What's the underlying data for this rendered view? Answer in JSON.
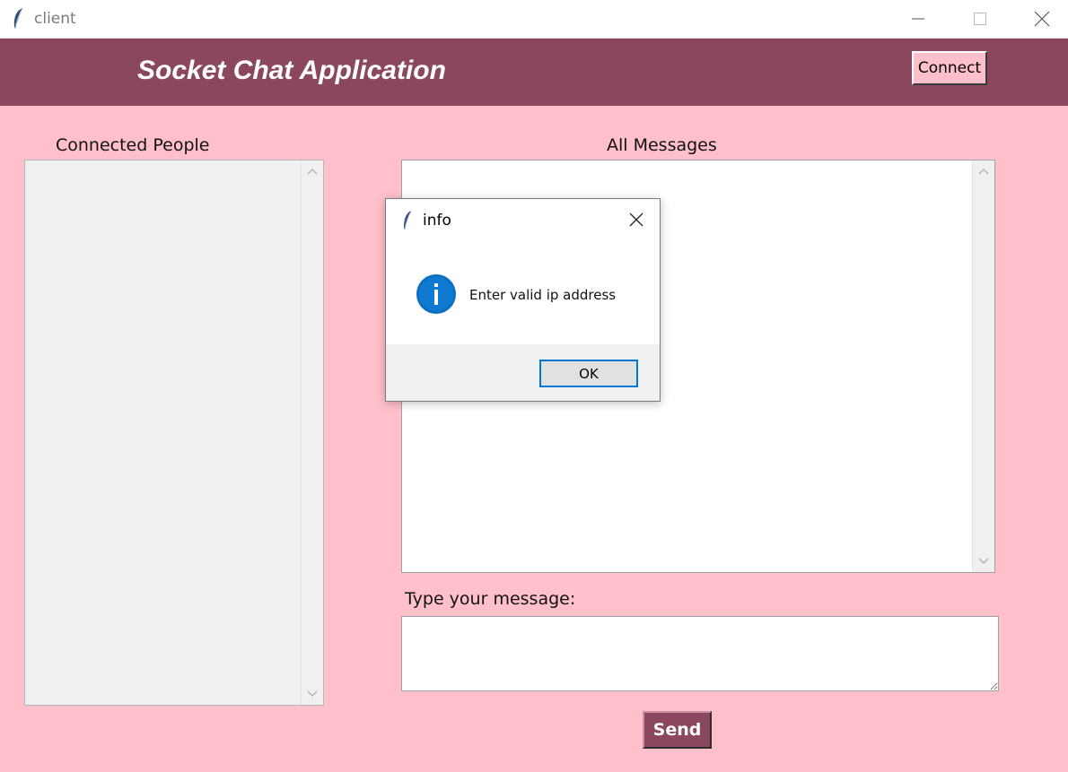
{
  "window": {
    "title": "client",
    "icon": "feather-icon",
    "controls": [
      "minimize-icon",
      "maximize-icon",
      "close-icon"
    ]
  },
  "header": {
    "title": "Socket Chat Application",
    "connect_label": "Connect"
  },
  "panels": {
    "people_label": "Connected People",
    "messages_label": "All Messages",
    "type_label": "Type your message:",
    "input_value": "",
    "send_label": "Send"
  },
  "dialog": {
    "title": "info",
    "message": "Enter valid ip address",
    "ok_label": "OK",
    "icon": "info-icon"
  },
  "colors": {
    "header_bg": "#8b475d",
    "app_bg": "#ffc0cb",
    "dialog_accent": "#0078d7"
  }
}
